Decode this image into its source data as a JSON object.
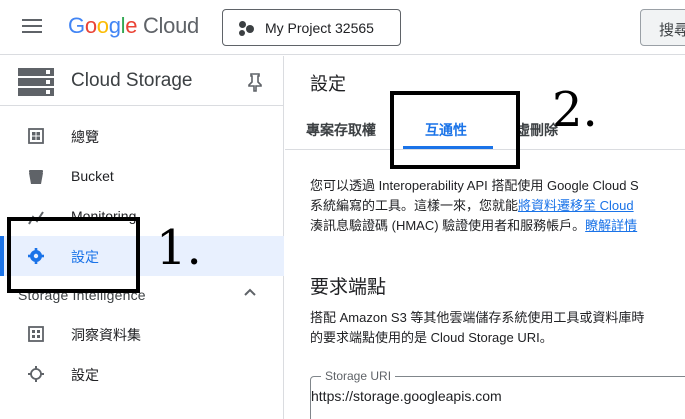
{
  "topbar": {
    "logo": {
      "g1": "G",
      "g2": "o",
      "g3": "o",
      "g4": "g",
      "g5": "l",
      "g6": "e",
      "cloud": " Cloud"
    },
    "project_name": "My Project 32565",
    "search_label": "搜尋"
  },
  "sidebar": {
    "title": "Cloud Storage",
    "items": [
      {
        "label": "總覽",
        "icon": "dashboard-icon"
      },
      {
        "label": "Bucket",
        "icon": "bucket-icon"
      },
      {
        "label": "Monitoring",
        "icon": "monitoring-icon"
      },
      {
        "label": "設定",
        "icon": "gear-icon",
        "active": true
      }
    ],
    "section": {
      "label": "Storage Intelligence",
      "items": [
        {
          "label": "洞察資料集",
          "icon": "grid-icon"
        },
        {
          "label": "設定",
          "icon": "gear-outline-icon"
        }
      ]
    }
  },
  "main": {
    "title": "設定",
    "tabs": [
      {
        "label": "專案存取權"
      },
      {
        "label": "互通性",
        "active": true
      },
      {
        "label": "虛刪除"
      }
    ],
    "intro": {
      "line1": "您可以透過 Interoperability API 搭配使用 Google Cloud S",
      "line2_prefix": "系統編寫的工具。這樣一來，您就能",
      "line2_link": "將資料遷移至 Cloud ",
      "line3_prefix": "湊訊息驗證碼 (HMAC) 驗證使用者和服務帳戶。",
      "line3_link": "瞭解詳情"
    },
    "endpoint": {
      "heading": "要求端點",
      "line1": "搭配 Amazon S3 等其他雲端儲存系統使用工具或資料庫時",
      "line2": "的要求端點使用的是 Cloud Storage URI。",
      "field_label": "Storage URI",
      "field_value": "https://storage.googleapis.com"
    }
  },
  "annotations": [
    {
      "label": "1."
    },
    {
      "label": "2."
    }
  ],
  "colors": {
    "accent": "#1a73e8",
    "active_bg": "#e8f0fe",
    "border": "#dadce0",
    "annotation": "#000000"
  }
}
